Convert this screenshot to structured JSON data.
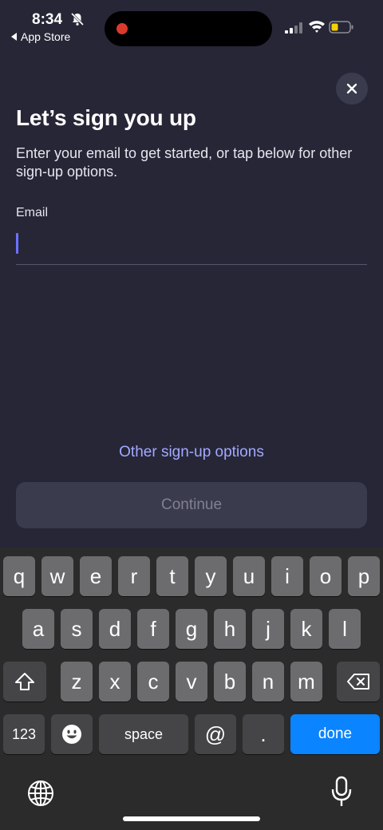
{
  "status": {
    "time": "8:34",
    "back_app": "App Store"
  },
  "header": {
    "title": "Let’s sign you up",
    "subtitle": "Enter your email to get started, or tap below for other sign-up options."
  },
  "form": {
    "email_label": "Email",
    "email_value": "",
    "email_placeholder": ""
  },
  "actions": {
    "other_options": "Other sign-up options",
    "continue": "Continue"
  },
  "keyboard": {
    "row1": [
      "q",
      "w",
      "e",
      "r",
      "t",
      "y",
      "u",
      "i",
      "o",
      "p"
    ],
    "row2": [
      "a",
      "s",
      "d",
      "f",
      "g",
      "h",
      "j",
      "k",
      "l"
    ],
    "row3": [
      "z",
      "x",
      "c",
      "v",
      "b",
      "n",
      "m"
    ],
    "numbers_key": "123",
    "space_key": "space",
    "at_key": "@",
    "dot_key": ".",
    "done_key": "done"
  },
  "icons": {
    "close": "close-icon",
    "bell_muted": "bell-slash-icon",
    "signal": "cellular-signal-icon",
    "wifi": "wifi-icon",
    "battery": "battery-low-icon",
    "shift": "shift-icon",
    "delete": "delete-icon",
    "emoji": "emoji-icon",
    "globe": "globe-icon",
    "mic": "microphone-icon"
  },
  "colors": {
    "background": "#262637",
    "accent_link": "#a3a9ff",
    "caret": "#6b73ff",
    "done_key": "#0a84ff",
    "battery_level": "#f5d000"
  }
}
